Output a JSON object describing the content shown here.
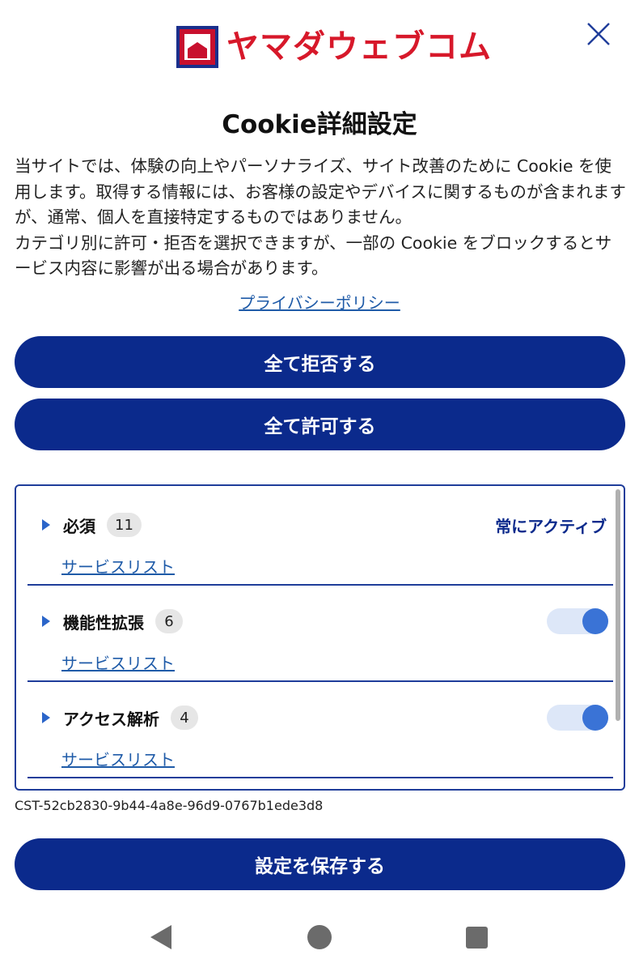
{
  "header": {
    "logo_text": "ヤマダウェブコム",
    "close_icon": "close-icon"
  },
  "title": "Cookie詳細設定",
  "description": {
    "paragraph1": "当サイトでは、体験の向上やパーソナライズ、サイト改善のために Cookie を使用します。取得する情報には、お客様の設定やデバイスに関するものが含まれますが、通常、個人を直接特定するものではありません。",
    "paragraph2": "カテゴリ別に許可・拒否を選択できますが、一部の Cookie をブロックするとサービス内容に影響が出る場合があります。"
  },
  "privacy_link": "プライバシーポリシー",
  "buttons": {
    "reject_all": "全て拒否する",
    "accept_all": "全て許可する",
    "save": "設定を保存する"
  },
  "categories": [
    {
      "name": "必須",
      "count": "11",
      "status": "常にアクティブ",
      "service_link": "サービスリスト"
    },
    {
      "name": "機能性拡張",
      "count": "6",
      "enabled": true,
      "service_link": "サービスリスト"
    },
    {
      "name": "アクセス解析",
      "count": "4",
      "enabled": true,
      "service_link": "サービスリスト"
    }
  ],
  "consent_id": "CST-52cb2830-9b44-4a8e-96d9-0767b1ede3d8",
  "colors": {
    "primary": "#0b2a8c",
    "link": "#1f5ba8",
    "brand_red": "#d7182a",
    "toggle_on": "#3a73d6"
  },
  "navbar": {
    "back_icon": "back-triangle-icon",
    "home_icon": "home-circle-icon",
    "recent_icon": "recent-square-icon"
  }
}
